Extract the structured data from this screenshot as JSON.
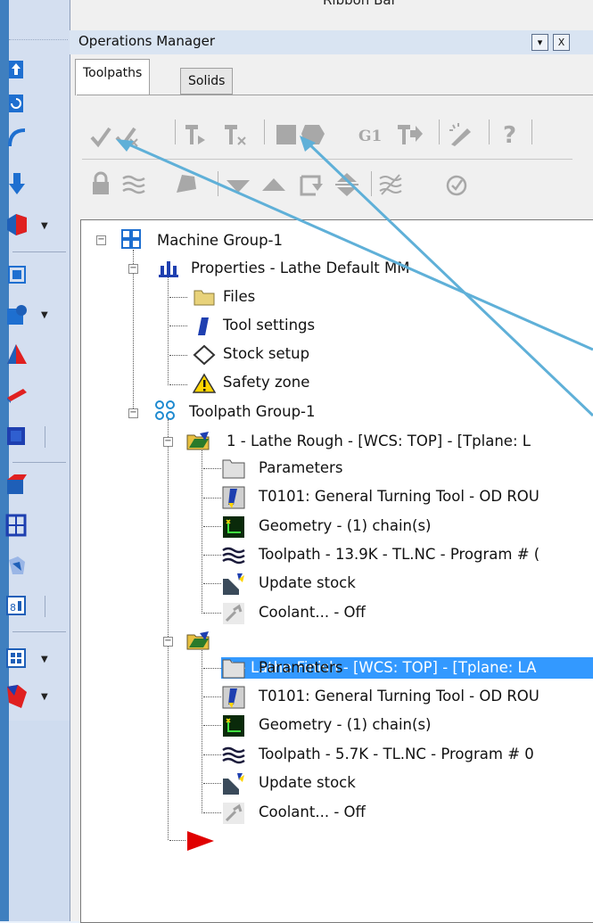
{
  "window": {
    "ribbon_label": "Ribbon Bar",
    "panel_title": "Operations Manager",
    "dropdown_button": "▾",
    "close_button": "X"
  },
  "tabs": [
    {
      "label": "Toolpaths",
      "active": true
    },
    {
      "label": "Solids",
      "active": false
    }
  ],
  "toolbar": {
    "row1": [
      "select-all-icon",
      "select-dirty-icon",
      "regenerate-icon",
      "regenerate-dirty-icon",
      "backplot-icon",
      "verify-icon",
      "simulate-g1-icon",
      "post-icon",
      "high-feed-icon",
      "help-icon"
    ],
    "row2": [
      "lock-icon",
      "toggle-posting-icon",
      "toggle-display-icon",
      "move-down-icon",
      "move-up-icon",
      "insert-arrow-icon",
      "scroll-icon",
      "toggle-lines-icon",
      "expand-collapse-icon"
    ],
    "g1_label": "G1"
  },
  "tree": {
    "machine_group": "Machine Group-1",
    "properties": "Properties - Lathe Default MM",
    "files": "Files",
    "tool_settings": "Tool settings",
    "stock_setup": "Stock setup",
    "safety_zone": "Safety zone",
    "toolpath_group": "Toolpath Group-1",
    "op1": {
      "title": "1 - Lathe Rough - [WCS: TOP] - [Tplane: L",
      "parameters": "Parameters",
      "tool": "T0101: General Turning Tool - OD ROU",
      "geometry": "Geometry - (1) chain(s)",
      "toolpath": "Toolpath - 13.9K - TL.NC - Program # (",
      "update_stock": "Update stock",
      "coolant": "Coolant... - Off"
    },
    "op2": {
      "title": "2 - Lathe Finish - [WCS: TOP] - [Tplane: LA",
      "parameters": "Parameters",
      "tool": "T0101: General Turning Tool - OD ROU",
      "geometry": "Geometry - (1) chain(s)",
      "toolpath": "Toolpath - 5.7K - TL.NC - Program # 0",
      "update_stock": "Update stock",
      "coolant": "Coolant... - Off"
    }
  },
  "colors": {
    "selection": "#3399ff",
    "annotation_arrow": "#5fb0d8",
    "insert_arrow": "#e00000"
  }
}
